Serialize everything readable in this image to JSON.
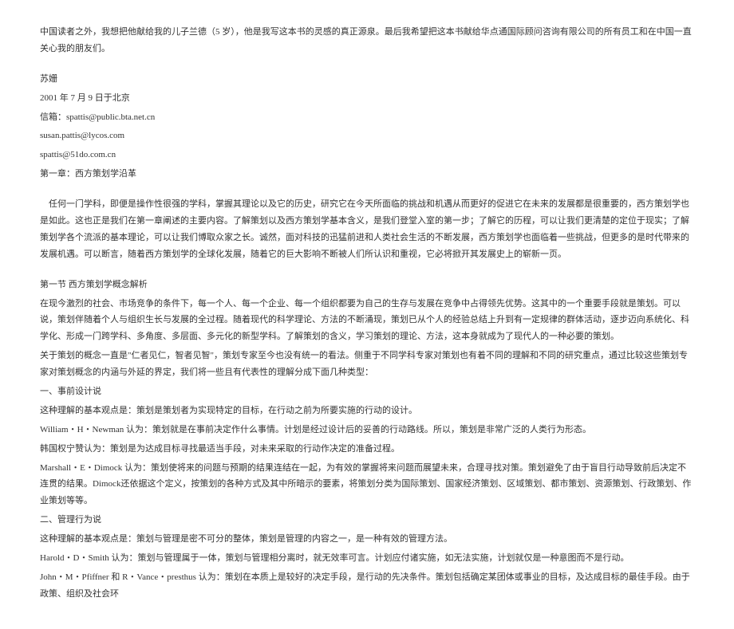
{
  "dedication": "中国读者之外，我想把他献给我的儿子兰德（5 岁），他是我写这本书的灵感的真正源泉。最后我希望把这本书献给华点通国际顾问咨询有限公司的所有员工和在中国一直关心我的朋友们。",
  "signature": {
    "name": "苏姗",
    "date_line": "2001 年 7 月 9 日于北京",
    "mailbox_label": "信箱：",
    "mailbox": "spattis@public.bta.net.cn",
    "email1": "susan.pattis@lycos.com",
    "email2": "spattis@51do.com.cn"
  },
  "chapter_title": "第一章：西方策划学沿革",
  "intro": "任何一门学科，即便是操作性很强的学科，掌握其理论以及它的历史，研究它在今天所面临的挑战和机遇从而更好的促进它在未来的发展都是很重要的，西方策划学也是如此。这也正是我们在第一章阐述的主要内容。了解策划以及西方策划学基本含义，是我们登堂入室的第一步；了解它的历程，可以让我们更清楚的定位于现实；了解策划学各个流派的基本理论，可以让我们博取众家之长。诚然，面对科技的迅猛前进和人类社会生活的不断发展，西方策划学也面临着一些挑战，但更多的是时代带来的发展机遇。可以断言，随着西方策划学的全球化发展，随着它的巨大影响不断被人们所认识和重视，它必将掀开其发展史上的崭新一页。",
  "section1": {
    "title": "第一节 西方策划学概念解析",
    "p1": "在现今激烈的社会、市场竞争的条件下，每一个人、每一个企业、每一个组织都要为自己的生存与发展在竞争中占得领先优势。这其中的一个重要手段就是策划。可以说，策划伴随着个人与组织生长与发展的全过程。随着现代的科学理论、方法的不断涌现，策划已从个人的经验总结上升到有一定规律的群体活动，逐步迈向系统化、科学化、形成一门跨学科、多角度、多层面、多元化的新型学科。了解策划的含义，学习策划的理论、方法，这本身就成为了现代人的一种必要的策划。",
    "p2": "关于策划的概念一直是\"仁者见仁，智者见智\"，策划专家至今也没有统一的看法。侧重于不同学科专家对策划也有着不同的理解和不同的研究重点，通过比较这些策划专家对策划概念的内涵与外延的界定，我们将一些且有代表性的理解分成下面几种类型：",
    "type1_title": "一、事前设计说",
    "type1_p1": "这种理解的基本观点是：策划是策划者为实现特定的目标，在行动之前为所要实施的行动的设计。",
    "type1_p2": "William・H・Newman 认为：策划就是在事前决定作什么事情。计划是经过设计后的妥善的行动路线。所以，策划是非常广泛的人类行为形态。",
    "type1_p3": "韩国权宁赞认为：策划是为达成目标寻找最适当手段，对未来采取的行动作决定的准备过程。",
    "type1_p4": "Marshall・E・Dimock 认为：策划使将来的问题与预期的结果连结在一起，为有效的掌握将来问题而展望未来，合理寻找对策。策划避免了由于盲目行动导致前后决定不连贯的结果。Dimock还依据这个定义，按策划的各种方式及其中所暗示的要素，将策划分类为国际策划、国家经济策划、区域策划、都市策划、资源策划、行政策划、作业策划等等。",
    "type2_title": "二、管理行为说",
    "type2_p1": "这种理解的基本观点是：策划与管理是密不可分的整体，策划是管理的内容之一，是一种有效的管理方法。",
    "type2_p2": "Harold・D・Smith 认为：策划与管理属于一体，策划与管理相分离时，就无效率可言。计划应付诸实施，如无法实施，计划就仅是一种意图而不是行动。",
    "type2_p3": "John・M・Pfiffner 和 R・Vance・presthus 认为：策划在本质上是较好的决定手段，是行动的先决条件。策划包括确定某团体或事业的目标，及达成目标的最佳手段。由于政策、组织及社会环"
  }
}
